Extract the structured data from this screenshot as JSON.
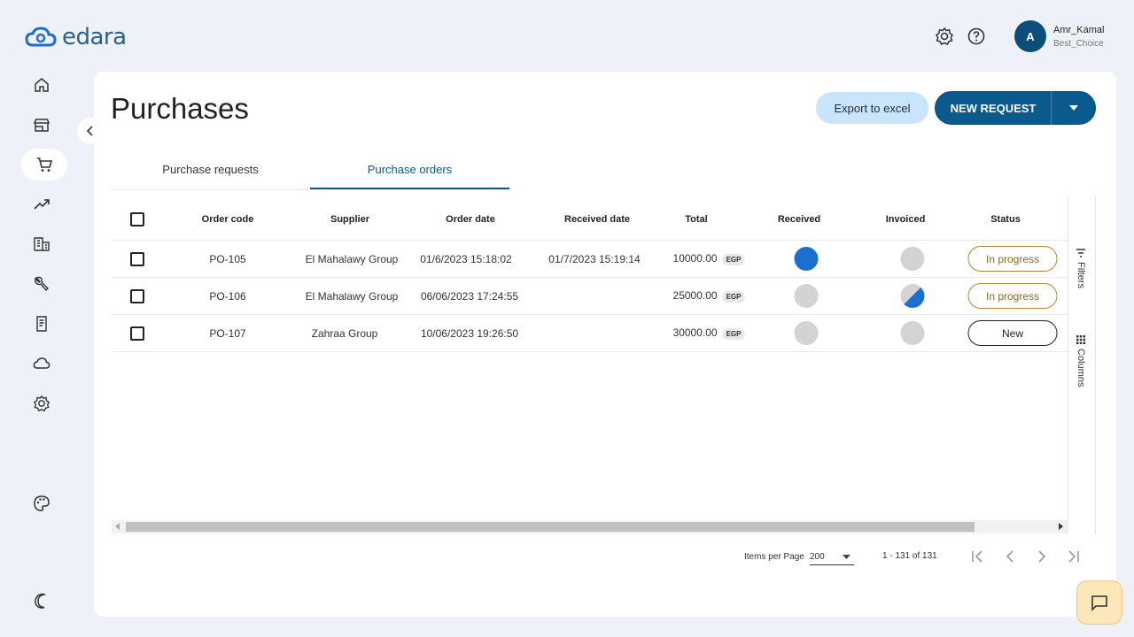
{
  "app": {
    "logo_text": "edara"
  },
  "user": {
    "initial": "A",
    "name": "Amr_Kamal",
    "company": "Best_Choice"
  },
  "page": {
    "title": "Purchases"
  },
  "actions": {
    "export_label": "Export to excel",
    "new_request_label": "NEW REQUEST"
  },
  "tabs": [
    {
      "label": "Purchase requests",
      "active": false
    },
    {
      "label": "Purchase orders",
      "active": true
    }
  ],
  "table": {
    "headers": {
      "order_code": "Order code",
      "supplier": "Supplier",
      "order_date": "Order date",
      "received_date": "Received date",
      "total": "Total",
      "received": "Received",
      "invoiced": "Invoiced",
      "status": "Status"
    },
    "rows": [
      {
        "order_code": "PO-105",
        "supplier": "El Mahalawy Group",
        "order_date": "01/6/2023 15:18:02",
        "received_date": "01/7/2023 15:19:14",
        "total": "10000.00",
        "currency": "EGP",
        "received": "full",
        "invoiced": "none",
        "status": "In progress"
      },
      {
        "order_code": "PO-106",
        "supplier": "El Mahalawy Group",
        "order_date": "06/06/2023 17:24:55",
        "received_date": "",
        "total": "25000.00",
        "currency": "EGP",
        "received": "none",
        "invoiced": "partial",
        "status": "In progress"
      },
      {
        "order_code": "PO-107",
        "supplier": "Zahraa Group",
        "order_date": "10/06/2023 19:26:50",
        "received_date": "",
        "total": "30000.00",
        "currency": "EGP",
        "received": "none",
        "invoiced": "none",
        "status": "New"
      }
    ]
  },
  "tool_panel": {
    "filters_label": "Filters",
    "columns_label": "Columns"
  },
  "pagination": {
    "items_per_page_label": "Items per Page",
    "items_per_page": "200",
    "range": "1 - 131 of 131"
  },
  "colors": {
    "primary": "#0a5a8e",
    "accent_blue": "#1b6fd1",
    "export_bg": "#c9e4fb",
    "chat_bg": "#fce7b8"
  }
}
